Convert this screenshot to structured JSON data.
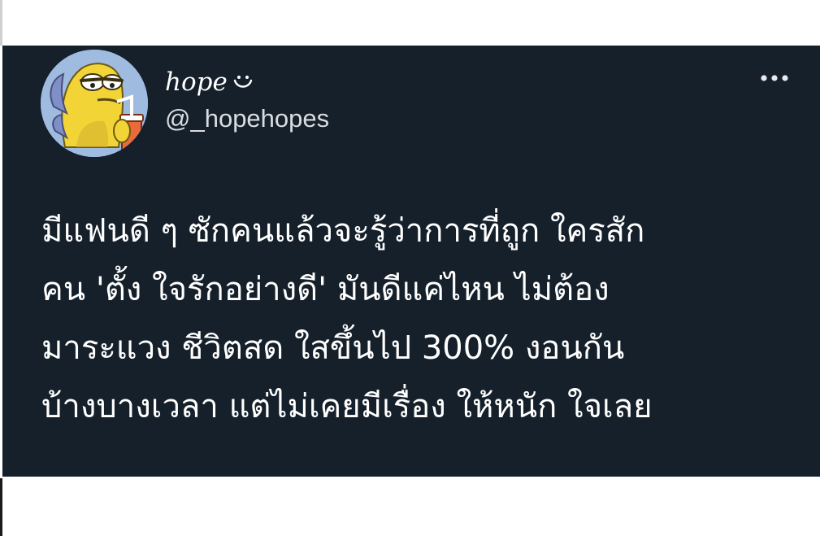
{
  "tweet": {
    "author": {
      "display_name": "hope",
      "display_name_emoji": "◡̈",
      "handle": "@_hopehopes",
      "avatar_icon": "fish-avatar-icon"
    },
    "menu_icon": "more-options-icon",
    "text_lines": [
      "มีแฟนดี ๆ ซักคนแล้วจะรู้ว่าการที่ถูก ใครสัก",
      "คน 'ตั้ง ใจรักอย่างดี' มันดีแค่ไหน ไม่ต้อง",
      "มาระแวง ชีวิตสด ใสขึ้นไป 300% งอนกัน",
      "บ้างบางเวลา แต่ไม่เคยมีเรื่อง ให้หนัก ใจเลย"
    ]
  },
  "colors": {
    "card_background": "#15202b",
    "text": "#ffffff",
    "secondary_text": "#d9dde1",
    "page_background": "#ffffff"
  }
}
